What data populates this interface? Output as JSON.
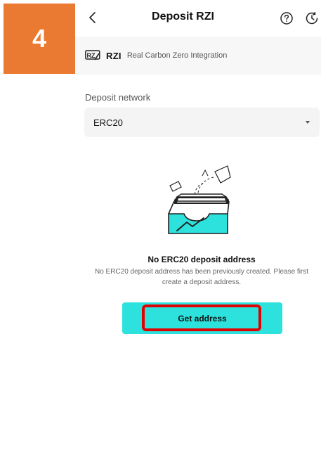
{
  "step": {
    "number": "4"
  },
  "header": {
    "title": "Deposit RZI"
  },
  "coin": {
    "symbol": "RZI",
    "name": "Real Carbon Zero Integration"
  },
  "network": {
    "label": "Deposit network",
    "selected": "ERC20"
  },
  "empty_state": {
    "title": "No ERC20 deposit address",
    "description": "No ERC20 deposit address has been previously created. Please first create a deposit address."
  },
  "actions": {
    "get_address_label": "Get address"
  },
  "colors": {
    "accent": "#2de2dd",
    "badge": "#ea7a31",
    "highlight": "#e00000"
  }
}
